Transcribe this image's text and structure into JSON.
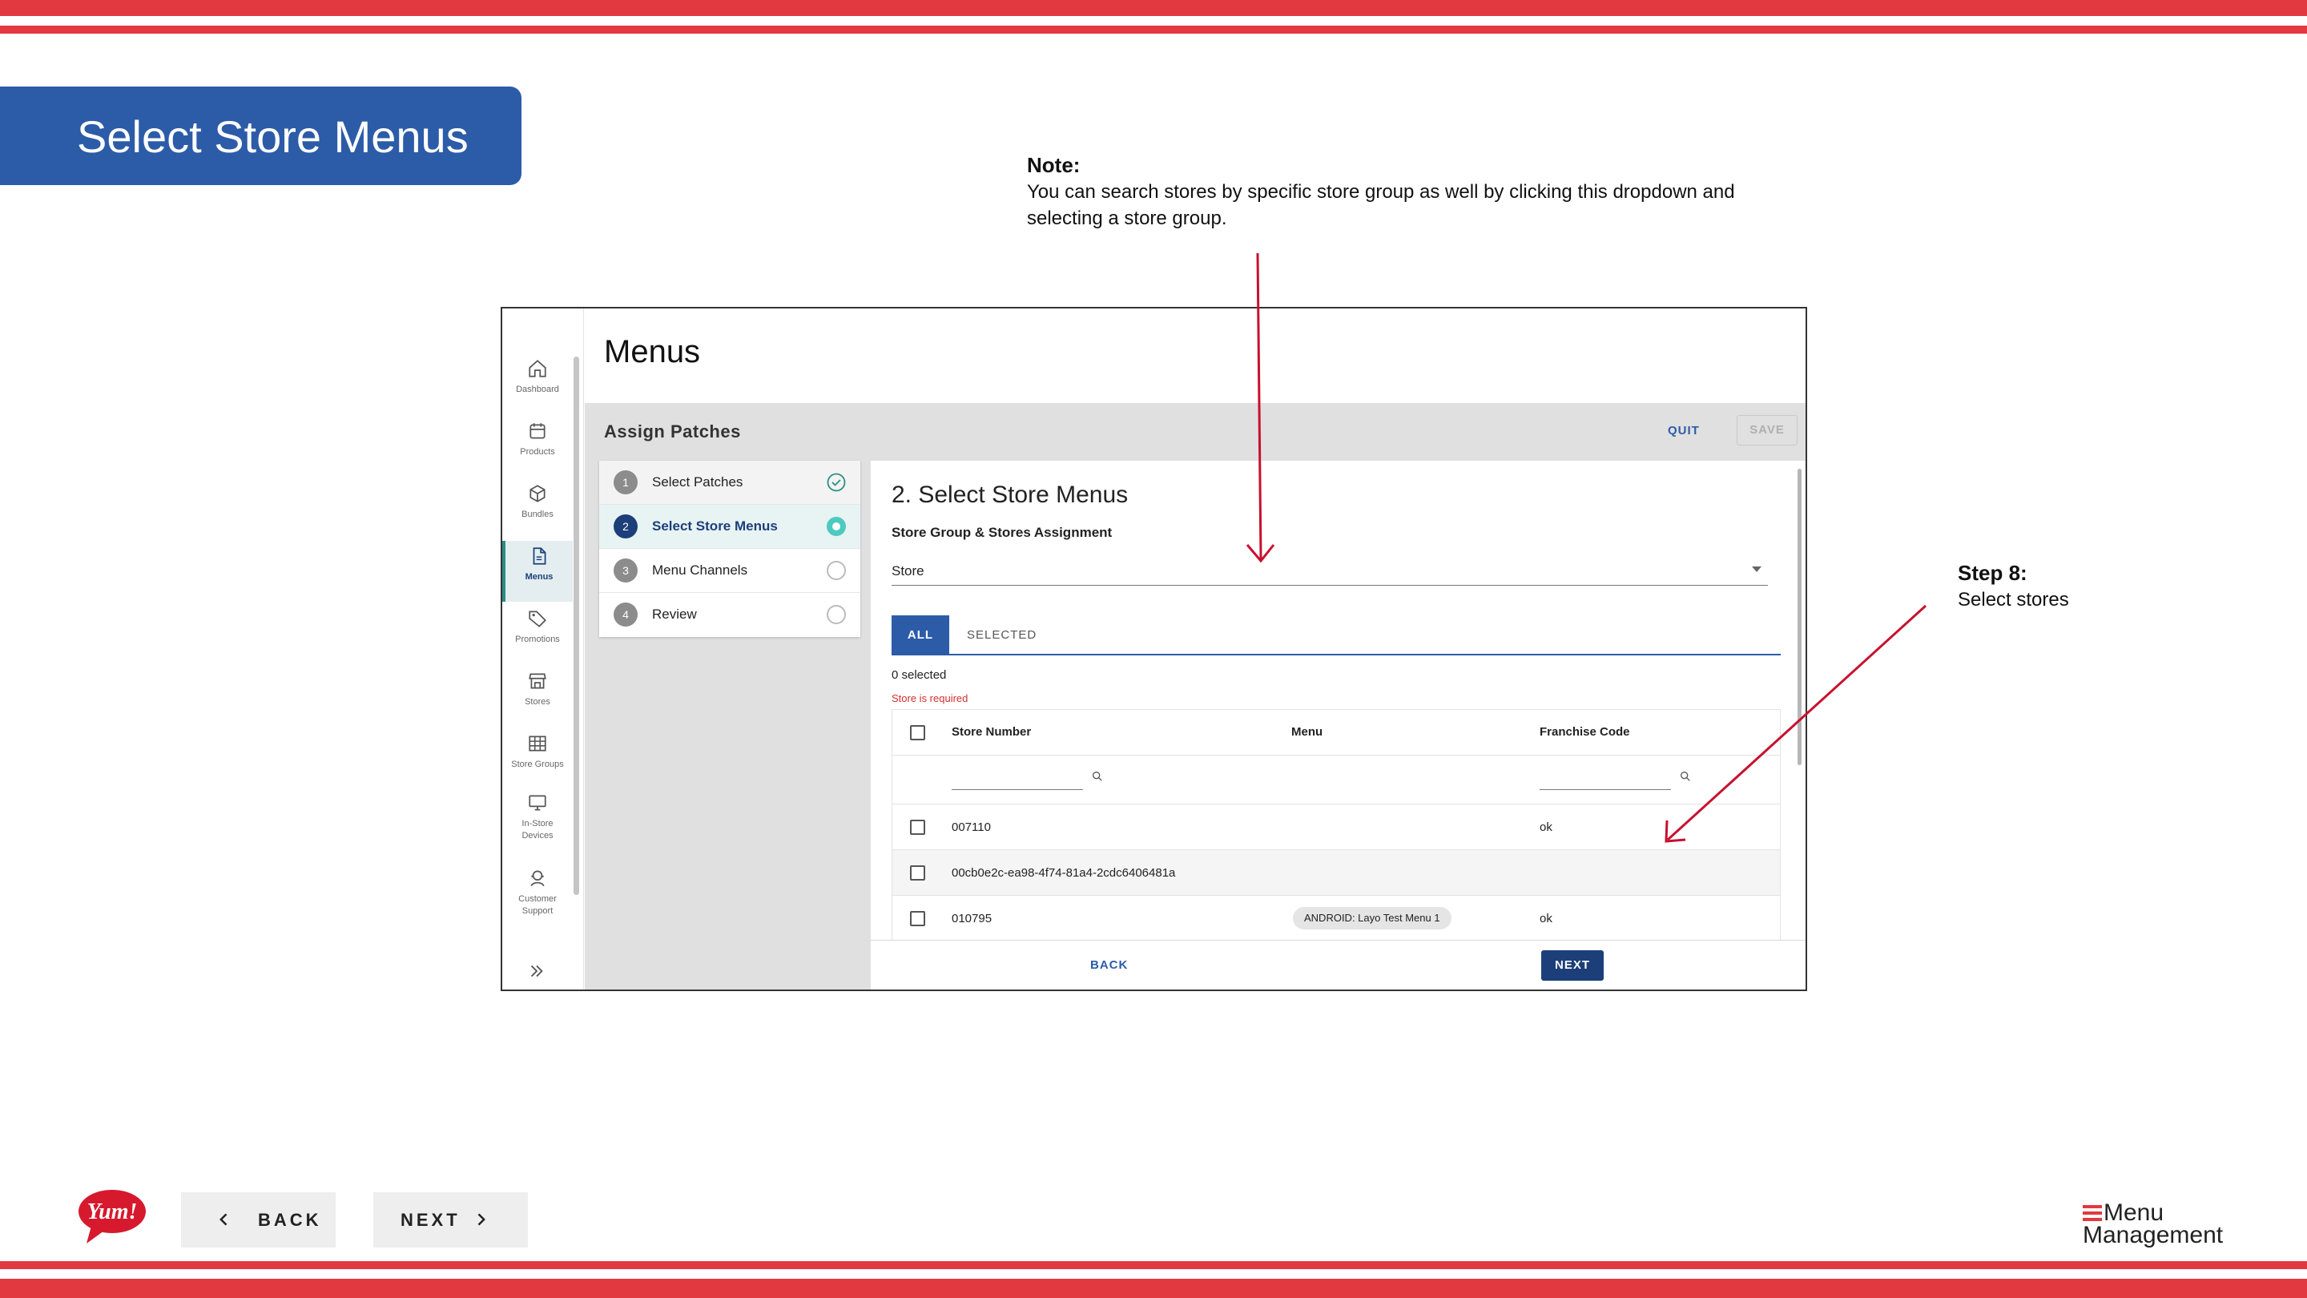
{
  "slide": {
    "title": "Select Store Menus",
    "note": {
      "heading": "Note:",
      "text": "You can search stores by specific store group as well by clicking this dropdown and selecting a store group."
    },
    "step": {
      "heading": "Step 8:",
      "text": "Select stores"
    },
    "nav": {
      "back_label": "BACK",
      "next_label": "NEXT"
    },
    "brand": {
      "yum_text": "Yum!",
      "product_line1": "Menu",
      "product_line2": "Management"
    },
    "colors": {
      "stripe": "#e2383f",
      "title_bar": "#2c5ca8",
      "arrow": "#c8102e"
    }
  },
  "app": {
    "sidebar": {
      "items": [
        {
          "label": "Dashboard",
          "icon": "home-icon"
        },
        {
          "label": "Products",
          "icon": "calendar-icon"
        },
        {
          "label": "Bundles",
          "icon": "cube-icon"
        },
        {
          "label": "Menus",
          "icon": "document-icon",
          "active": true
        },
        {
          "label": "Promotions",
          "icon": "tag-icon"
        },
        {
          "label": "Stores",
          "icon": "storefront-icon"
        },
        {
          "label": "Store Groups",
          "icon": "grid-icon"
        },
        {
          "label": "In-Store Devices",
          "icon": "monitor-icon"
        },
        {
          "label": "Customer Support",
          "icon": "support-agent-icon"
        }
      ],
      "expand_icon": "double-chevron-right-icon"
    },
    "page_title": "Menus",
    "section_title": "Assign Patches",
    "quit_label": "QUIT",
    "save_label": "SAVE",
    "steps": [
      {
        "num": "1",
        "label": "Select Patches",
        "status": "done"
      },
      {
        "num": "2",
        "label": "Select Store Menus",
        "status": "current"
      },
      {
        "num": "3",
        "label": "Menu Channels",
        "status": "todo"
      },
      {
        "num": "4",
        "label": "Review",
        "status": "todo"
      }
    ],
    "panel": {
      "title": "2. Select Store Menus",
      "subtitle": "Store Group & Stores Assignment",
      "select_value": "Store",
      "tabs": {
        "all": "ALL",
        "selected": "SELECTED"
      },
      "selected_count": "0 selected",
      "error": "Store is required",
      "table": {
        "headers": {
          "store_number": "Store Number",
          "menu": "Menu",
          "franchise_code": "Franchise Code"
        },
        "rows": [
          {
            "store_number": "007110",
            "menu": "",
            "franchise_code": "ok"
          },
          {
            "store_number": "00cb0e2c-ea98-4f74-81a4-2cdc6406481a",
            "menu": "",
            "franchise_code": ""
          },
          {
            "store_number": "010795",
            "menu": "ANDROID: Layo Test Menu 1",
            "franchise_code": "ok"
          }
        ]
      },
      "back_label": "BACK",
      "next_label": "NEXT"
    }
  }
}
